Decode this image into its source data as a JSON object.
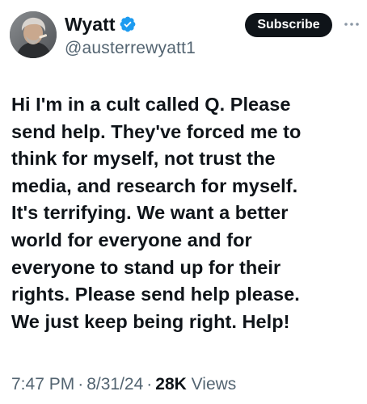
{
  "author": {
    "display_name": "Wyatt",
    "handle": "@austerrewyatt1",
    "verified": true,
    "avatar_icon": "user-avatar"
  },
  "actions": {
    "subscribe_label": "Subscribe",
    "more_icon": "more-horizontal-icon"
  },
  "tweet": {
    "text": "Hi I'm in a cult called Q. Please\nsend help. They've forced me to\nthink for myself, not trust the\nmedia, and research for myself.\nIt's terrifying. We want a better\nworld for everyone and for\neveryone to stand up for their\nrights. Please send help please.\nWe just keep being right. Help!"
  },
  "meta": {
    "time": "7:47 PM",
    "separator": "·",
    "date": "8/31/24",
    "views_count": "28K",
    "views_label": "Views"
  },
  "colors": {
    "text": "#0f1419",
    "secondary": "#536471",
    "verified_blue": "#1d9bf0",
    "button_bg": "#0f1419"
  }
}
